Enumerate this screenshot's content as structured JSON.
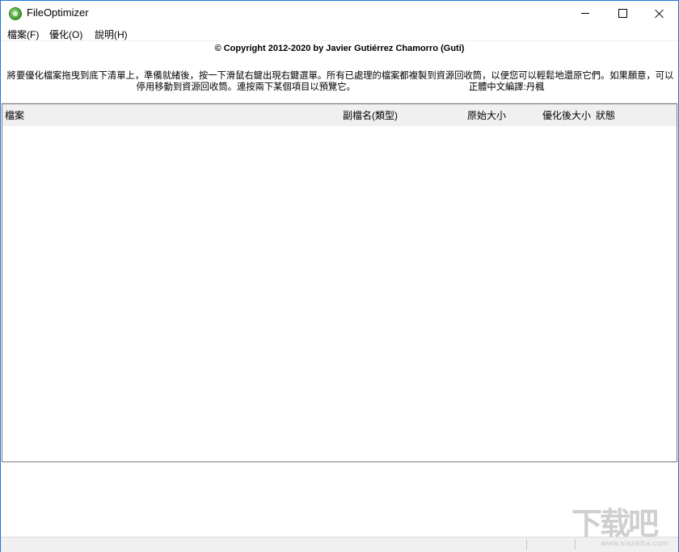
{
  "window": {
    "title": "FileOptimizer",
    "controls": {
      "minimize": "minimize",
      "maximize": "maximize",
      "close": "close"
    }
  },
  "menu": {
    "items": [
      {
        "label": "檔案(F)"
      },
      {
        "label": "優化(O)"
      },
      {
        "label": "說明(H)"
      }
    ]
  },
  "header": {
    "copyright": "© Copyright 2012-2020 by Javier Gutiérrez Chamorro (Guti)",
    "instructions": "將要優化檔案拖曳到底下清單上，準備就緒後，按一下滑鼠右鍵出現右鍵選單。所有已處理的檔案都複製到資源回收筒，以便您可以輕鬆地還原它們。如果願意，可以停用移動到資源回收筒。連按兩下某個項目以預覽它。",
    "translator": "正體中文編譯:丹楓"
  },
  "list": {
    "columns": [
      "檔案",
      "副檔名(類型)",
      "原始大小",
      "優化後大小",
      "狀態"
    ],
    "rows": []
  },
  "statusbar": {
    "panels": [
      "",
      ""
    ]
  },
  "watermark": {
    "big": "下载吧",
    "small": "www.xiazaiba.com"
  },
  "colors": {
    "accent": "#1e78d7",
    "header_bg": "#f0f0f0"
  }
}
